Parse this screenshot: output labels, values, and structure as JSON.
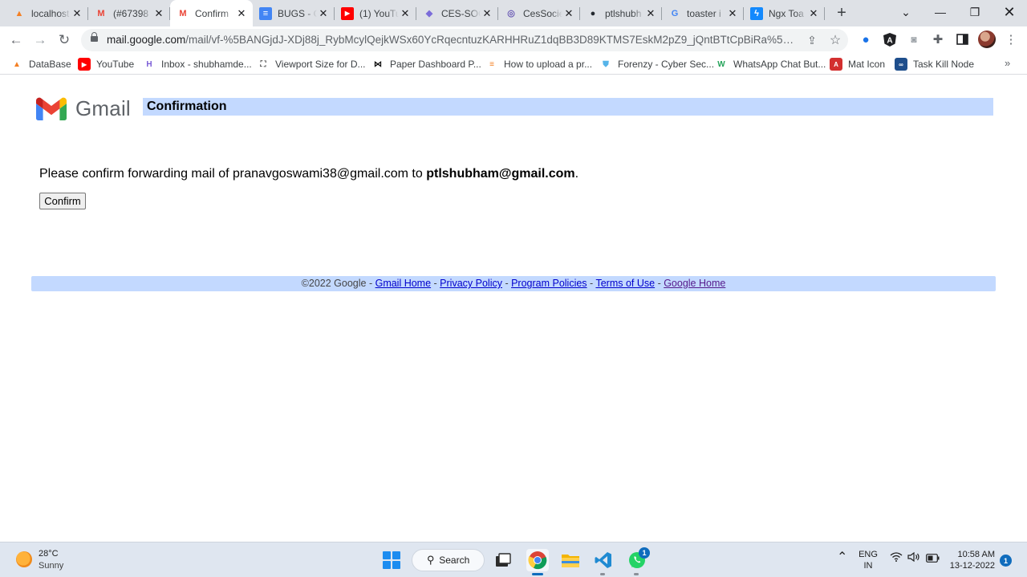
{
  "browser": {
    "tabs": [
      {
        "title": "localhost",
        "icon": "stackoverflow-like-icon",
        "color": "#f48024"
      },
      {
        "title": "(#67398",
        "icon": "gmail-icon",
        "color": "#ea4335"
      },
      {
        "title": "Confirm",
        "icon": "gmail-icon",
        "color": "#ea4335"
      },
      {
        "title": "BUGS - G",
        "icon": "google-docs-icon",
        "color": "#4285f4"
      },
      {
        "title": "(1) YouTu",
        "icon": "youtube-icon",
        "color": "#ff0000"
      },
      {
        "title": "CES-SOC",
        "icon": "layers-icon",
        "color": "#7b6cd9"
      },
      {
        "title": "CesSocie",
        "icon": "cessociety-icon",
        "color": "#6b5bb5"
      },
      {
        "title": "ptlshubh",
        "icon": "github-icon",
        "color": "#24292f"
      },
      {
        "title": "toaster i",
        "icon": "google-icon",
        "color": "#4285f4"
      },
      {
        "title": "Ngx Toa",
        "icon": "stackblitz-icon",
        "color": "#1389fd"
      }
    ],
    "url_host": "mail.google.com",
    "url_path": "/mail/vf-%5BANGjdJ-XDj88j_RybMcylQejkWSx60YcRqecntuzKARHHRuZ1dqBB3D89KTMS7EskM2pZ9_jQntBTtCpBiRa%5D-OpNfkA...",
    "bookmarks": [
      {
        "label": "DataBase",
        "icon": "database-bookmark-icon",
        "color": "#f48024"
      },
      {
        "label": "YouTube",
        "icon": "youtube-icon",
        "color": "#ff0000"
      },
      {
        "label": "Inbox - shubhamde...",
        "icon": "inbox-icon",
        "color": "#7b5cd6"
      },
      {
        "label": "Viewport Size for D...",
        "icon": "viewport-icon",
        "color": "#555555"
      },
      {
        "label": "Paper Dashboard P...",
        "icon": "bowtie-icon",
        "color": "#111111"
      },
      {
        "label": "How to upload a pr...",
        "icon": "stackoverflow-icon",
        "color": "#f48024"
      },
      {
        "label": "Forenzy - Cyber Sec...",
        "icon": "shield-icon",
        "color": "#56b4e9"
      },
      {
        "label": "WhatsApp Chat But...",
        "icon": "w-logo-icon",
        "color": "#25a35a"
      },
      {
        "label": "Mat Icon",
        "icon": "angular-material-icon",
        "color": "#d32f2f"
      },
      {
        "label": "Task Kill Node",
        "icon": "infinity-icon",
        "color": "#1e4e8c"
      }
    ]
  },
  "page": {
    "logo_text": "Gmail",
    "header_title": "Confirmation",
    "message_prefix": "Please confirm forwarding mail of pranavgoswami38@gmail.com to ",
    "message_email": "ptlshubham@gmail.com",
    "message_suffix": ".",
    "confirm_label": "Confirm",
    "footer": {
      "copyright": "©2022 Google - ",
      "links": [
        "Gmail Home",
        "Privacy Policy",
        "Program Policies",
        "Terms of Use",
        "Google Home"
      ],
      "separator": " - "
    }
  },
  "taskbar": {
    "temperature": "28°C",
    "condition": "Sunny",
    "search_label": "Search",
    "lang_top": "ENG",
    "lang_bottom": "IN",
    "time": "10:58 AM",
    "date": "13-12-2022",
    "notification_count": "1",
    "whatsapp_badge": "1"
  }
}
